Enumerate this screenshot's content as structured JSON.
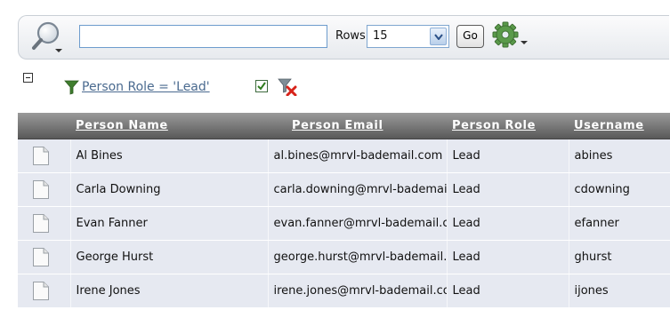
{
  "toolbar": {
    "search_icon": "magnifier-dropdown-icon",
    "search_value": "",
    "rows_label": "Rows",
    "rows_value": "15",
    "go_label": "Go",
    "actions_icon": "gear-dropdown-icon"
  },
  "filter": {
    "text": "Person Role = 'Lead'",
    "enabled": true,
    "filter_icon": "funnel-icon",
    "remove_icon": "remove-filter-icon"
  },
  "table": {
    "columns": [
      "Person Name",
      "Person Email",
      "Person Role",
      "Username"
    ],
    "rows": [
      {
        "name": "Al Bines",
        "email": "al.bines@mrvl-bademail.com",
        "role": "Lead",
        "username": "abines"
      },
      {
        "name": "Carla Downing",
        "email": "carla.downing@mrvl-bademail.com",
        "role": "Lead",
        "username": "cdowning"
      },
      {
        "name": "Evan Fanner",
        "email": "evan.fanner@mrvl-bademail.com",
        "role": "Lead",
        "username": "efanner"
      },
      {
        "name": "George Hurst",
        "email": "george.hurst@mrvl-bademail.com",
        "role": "Lead",
        "username": "ghurst"
      },
      {
        "name": "Irene Jones",
        "email": "irene.jones@mrvl-bademail.com",
        "role": "Lead",
        "username": "ijones"
      }
    ]
  },
  "colors": {
    "header_gradient_top": "#9a9a9a",
    "header_gradient_bottom": "#595959",
    "row_background": "#e6e9f1",
    "filter_link": "#4a6a8f",
    "input_border": "#6d9ccd"
  }
}
